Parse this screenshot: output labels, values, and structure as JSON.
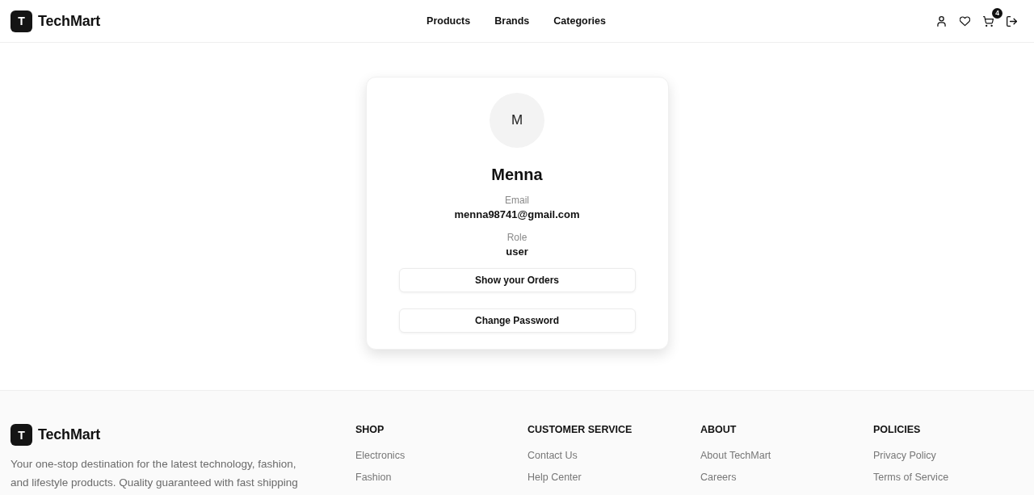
{
  "header": {
    "brand": {
      "logo_letter": "T",
      "name": "TechMart"
    },
    "nav": [
      "Products",
      "Brands",
      "Categories"
    ],
    "cart_count": "4"
  },
  "profile": {
    "avatar_initial": "M",
    "name": "Menna",
    "fields": [
      {
        "label": "Email",
        "value": "menna98741@gmail.com"
      },
      {
        "label": "Role",
        "value": "user"
      }
    ],
    "buttons": [
      "Show your Orders",
      "Change Password"
    ]
  },
  "footer": {
    "brand": {
      "logo_letter": "T",
      "name": "TechMart"
    },
    "description_lines": [
      "Your one-stop destination for the latest technology, fashion,",
      "and lifestyle products. Quality guaranteed with fast shipping"
    ],
    "columns": [
      {
        "title": "SHOP",
        "links": [
          "Electronics",
          "Fashion"
        ]
      },
      {
        "title": "CUSTOMER SERVICE",
        "links": [
          "Contact Us",
          "Help Center"
        ]
      },
      {
        "title": "ABOUT",
        "links": [
          "About TechMart",
          "Careers"
        ]
      },
      {
        "title": "POLICIES",
        "links": [
          "Privacy Policy",
          "Terms of Service"
        ]
      }
    ]
  }
}
